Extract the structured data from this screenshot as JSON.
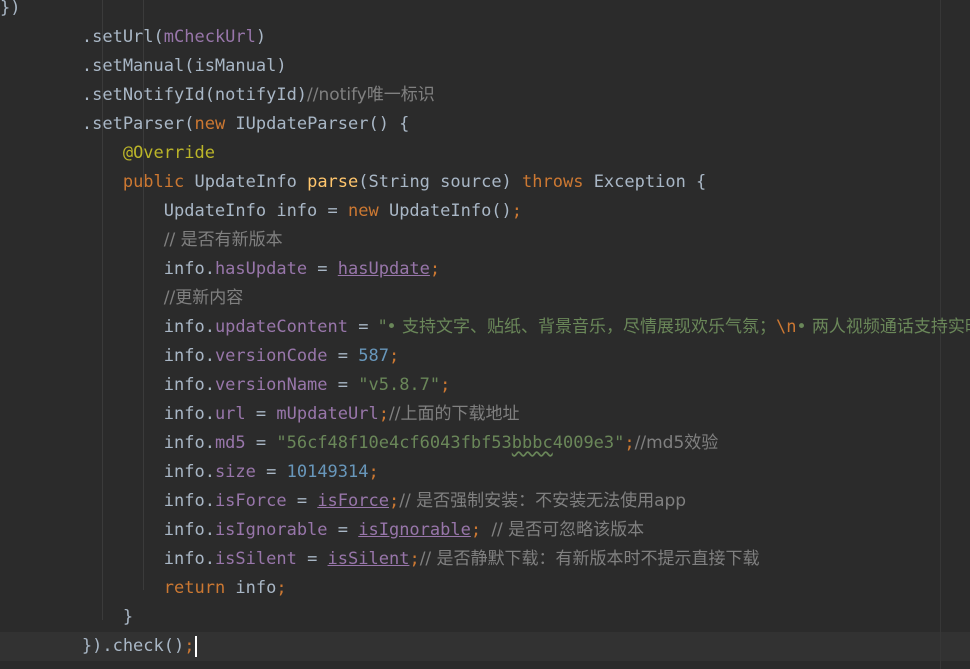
{
  "editor": {
    "colors": {
      "background": "#2b2b2b",
      "current_line": "#323232",
      "keyword": "#cc7832",
      "method": "#ffc66d",
      "field": "#9876aa",
      "number": "#6897bb",
      "string": "#6a8759",
      "comment": "#808080",
      "annotation": "#bbb529",
      "text": "#a9b7c6"
    },
    "lines": [
      {
        "tokens": [
          {
            "t": "})",
            "c": "plain"
          }
        ]
      },
      {
        "tokens": [
          {
            "t": "        .setUrl(",
            "c": "plain"
          },
          {
            "t": "mCheckUrl",
            "c": "fld"
          },
          {
            "t": ")",
            "c": "plain"
          }
        ]
      },
      {
        "tokens": [
          {
            "t": "        .setManual(isManual)",
            "c": "plain"
          }
        ]
      },
      {
        "tokens": [
          {
            "t": "        .setNotifyId(notifyId)",
            "c": "plain"
          },
          {
            "t": "//notify唯一标识",
            "c": "cmt"
          }
        ]
      },
      {
        "tokens": [
          {
            "t": "        .setParser(",
            "c": "plain"
          },
          {
            "t": "new ",
            "c": "kw"
          },
          {
            "t": "IUpdateParser() {",
            "c": "plain"
          }
        ]
      },
      {
        "tokens": [
          {
            "t": "            ",
            "c": "plain"
          },
          {
            "t": "@Override",
            "c": "ann"
          }
        ]
      },
      {
        "tokens": [
          {
            "t": "            ",
            "c": "plain"
          },
          {
            "t": "public ",
            "c": "kw"
          },
          {
            "t": "UpdateInfo ",
            "c": "plain"
          },
          {
            "t": "parse",
            "c": "fn"
          },
          {
            "t": "(String source) ",
            "c": "plain"
          },
          {
            "t": "throws ",
            "c": "kw"
          },
          {
            "t": "Exception {",
            "c": "plain"
          }
        ]
      },
      {
        "tokens": [
          {
            "t": "                UpdateInfo info = ",
            "c": "plain"
          },
          {
            "t": "new ",
            "c": "kw"
          },
          {
            "t": "UpdateInfo()",
            "c": "plain"
          },
          {
            "t": ";",
            "c": "kw"
          }
        ]
      },
      {
        "tokens": [
          {
            "t": "                ",
            "c": "plain"
          },
          {
            "t": "// 是否有新版本",
            "c": "cmt"
          }
        ]
      },
      {
        "tokens": [
          {
            "t": "                info.",
            "c": "plain"
          },
          {
            "t": "hasUpdate",
            "c": "fld"
          },
          {
            "t": " = ",
            "c": "plain"
          },
          {
            "t": "hasUpdate",
            "c": "fld ul"
          },
          {
            "t": ";",
            "c": "kw"
          }
        ]
      },
      {
        "tokens": [
          {
            "t": "                ",
            "c": "plain"
          },
          {
            "t": "//更新内容",
            "c": "cmt"
          }
        ]
      },
      {
        "tokens": [
          {
            "t": "                info.",
            "c": "plain"
          },
          {
            "t": "updateContent",
            "c": "fld"
          },
          {
            "t": " = ",
            "c": "plain"
          },
          {
            "t": "\"• 支持文字、贴纸、背景音乐，尽情展现欢乐气氛；",
            "c": "str"
          },
          {
            "t": "\\n",
            "c": "kw"
          },
          {
            "t": "• 两人视频通话支持实时滤镜",
            "c": "str"
          }
        ]
      },
      {
        "tokens": [
          {
            "t": "                info.",
            "c": "plain"
          },
          {
            "t": "versionCode",
            "c": "fld"
          },
          {
            "t": " = ",
            "c": "plain"
          },
          {
            "t": "587",
            "c": "num"
          },
          {
            "t": ";",
            "c": "kw"
          }
        ]
      },
      {
        "tokens": [
          {
            "t": "                info.",
            "c": "plain"
          },
          {
            "t": "versionName",
            "c": "fld"
          },
          {
            "t": " = ",
            "c": "plain"
          },
          {
            "t": "\"v5.8.7\"",
            "c": "str"
          },
          {
            "t": ";",
            "c": "kw"
          }
        ]
      },
      {
        "tokens": [
          {
            "t": "                info.",
            "c": "plain"
          },
          {
            "t": "url",
            "c": "fld"
          },
          {
            "t": " = ",
            "c": "plain"
          },
          {
            "t": "mUpdateUrl",
            "c": "fld"
          },
          {
            "t": ";",
            "c": "kw"
          },
          {
            "t": "//上面的下载地址",
            "c": "cmt"
          }
        ]
      },
      {
        "tokens": [
          {
            "t": "                info.",
            "c": "plain"
          },
          {
            "t": "md5",
            "c": "fld"
          },
          {
            "t": " = ",
            "c": "plain"
          },
          {
            "t": "\"56cf48f10e4cf6043fbf53",
            "c": "str"
          },
          {
            "t": "bbbc",
            "c": "str squig"
          },
          {
            "t": "4009e3\"",
            "c": "str"
          },
          {
            "t": ";",
            "c": "kw"
          },
          {
            "t": "//md5效验",
            "c": "cmt"
          }
        ]
      },
      {
        "tokens": [
          {
            "t": "                info.",
            "c": "plain"
          },
          {
            "t": "size",
            "c": "fld"
          },
          {
            "t": " = ",
            "c": "plain"
          },
          {
            "t": "10149314",
            "c": "num"
          },
          {
            "t": ";",
            "c": "kw"
          }
        ]
      },
      {
        "tokens": [
          {
            "t": "                info.",
            "c": "plain"
          },
          {
            "t": "isForce",
            "c": "fld"
          },
          {
            "t": " = ",
            "c": "plain"
          },
          {
            "t": "isForce",
            "c": "fld ul"
          },
          {
            "t": ";",
            "c": "kw"
          },
          {
            "t": "// 是否强制安装：不安装无法使用app",
            "c": "cmt"
          }
        ]
      },
      {
        "tokens": [
          {
            "t": "                info.",
            "c": "plain"
          },
          {
            "t": "isIgnorable",
            "c": "fld"
          },
          {
            "t": " = ",
            "c": "plain"
          },
          {
            "t": "isIgnorable",
            "c": "fld ul"
          },
          {
            "t": "; ",
            "c": "kw"
          },
          {
            "t": "// 是否可忽略该版本",
            "c": "cmt"
          }
        ]
      },
      {
        "tokens": [
          {
            "t": "                info.",
            "c": "plain"
          },
          {
            "t": "isSilent",
            "c": "fld"
          },
          {
            "t": " = ",
            "c": "plain"
          },
          {
            "t": "isSilent",
            "c": "fld ul"
          },
          {
            "t": ";",
            "c": "kw"
          },
          {
            "t": "// 是否静默下载：有新版本时不提示直接下载",
            "c": "cmt"
          }
        ]
      },
      {
        "tokens": [
          {
            "t": "                ",
            "c": "plain"
          },
          {
            "t": "return ",
            "c": "kw"
          },
          {
            "t": "info",
            "c": "plain"
          },
          {
            "t": ";",
            "c": "kw"
          }
        ]
      },
      {
        "tokens": [
          {
            "t": "            }",
            "c": "plain"
          }
        ]
      },
      {
        "tokens": [
          {
            "t": "        }).check()",
            "c": "plain"
          },
          {
            "t": ";",
            "c": "kw"
          }
        ],
        "caret": true
      }
    ]
  }
}
